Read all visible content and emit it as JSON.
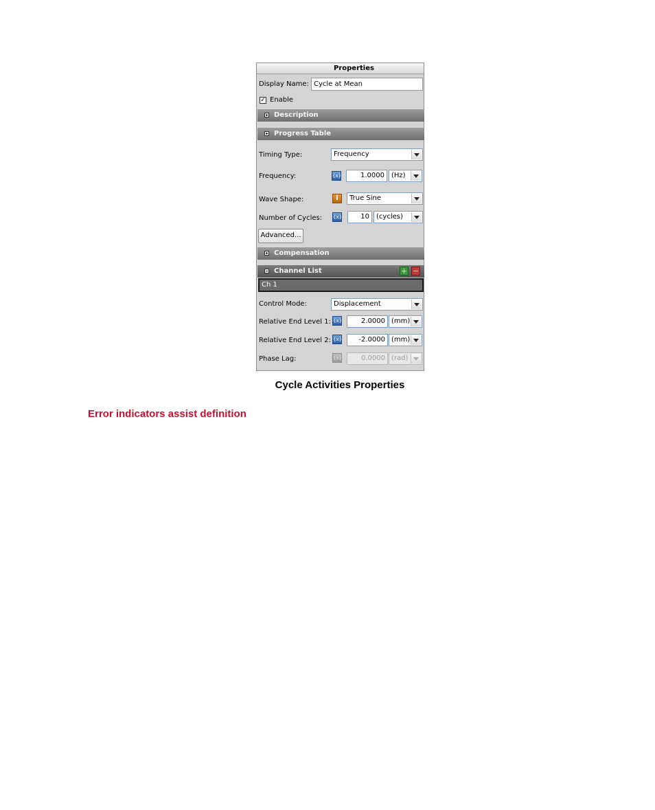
{
  "panel": {
    "title": "Properties",
    "display_name_label": "Display Name:",
    "display_name_value": "Cycle at Mean",
    "enable_label": "Enable",
    "enable_checked": true,
    "sections": {
      "description": "Description",
      "progress_table": "Progress Table",
      "compensation": "Compensation",
      "channel_list": "Channel List"
    },
    "timing_type": {
      "label": "Timing Type:",
      "value": "Frequency"
    },
    "frequency": {
      "label": "Frequency:",
      "value": "1.0000",
      "unit": "(Hz)"
    },
    "wave_shape": {
      "label": "Wave Shape:",
      "value": "True Sine"
    },
    "number_of_cycles": {
      "label": "Number of Cycles:",
      "value": "10",
      "unit": "(cycles)"
    },
    "advanced_button": "Advanced...",
    "channel_list_items": [
      "Ch 1"
    ],
    "control_mode": {
      "label": "Control Mode:",
      "value": "Displacement"
    },
    "relative_end_level_1": {
      "label": "Relative End Level 1:",
      "value": "2.0000",
      "unit": "(mm)"
    },
    "relative_end_level_2": {
      "label": "Relative End Level 2:",
      "value": "-2.0000",
      "unit": "(mm)"
    },
    "phase_lag": {
      "label": "Phase Lag:",
      "value": "0.0000",
      "unit": "(rad)"
    },
    "icons": {
      "variable": "variable-icon",
      "info": "info-icon",
      "add": "add-channel-icon",
      "remove": "remove-channel-icon"
    }
  },
  "caption": "Cycle Activities Properties",
  "heading": "Error indicators assist definition",
  "colors": {
    "heading": "#c8102e",
    "section_bar": "#7f7f7f",
    "panel_bg": "#d4d4d4"
  }
}
